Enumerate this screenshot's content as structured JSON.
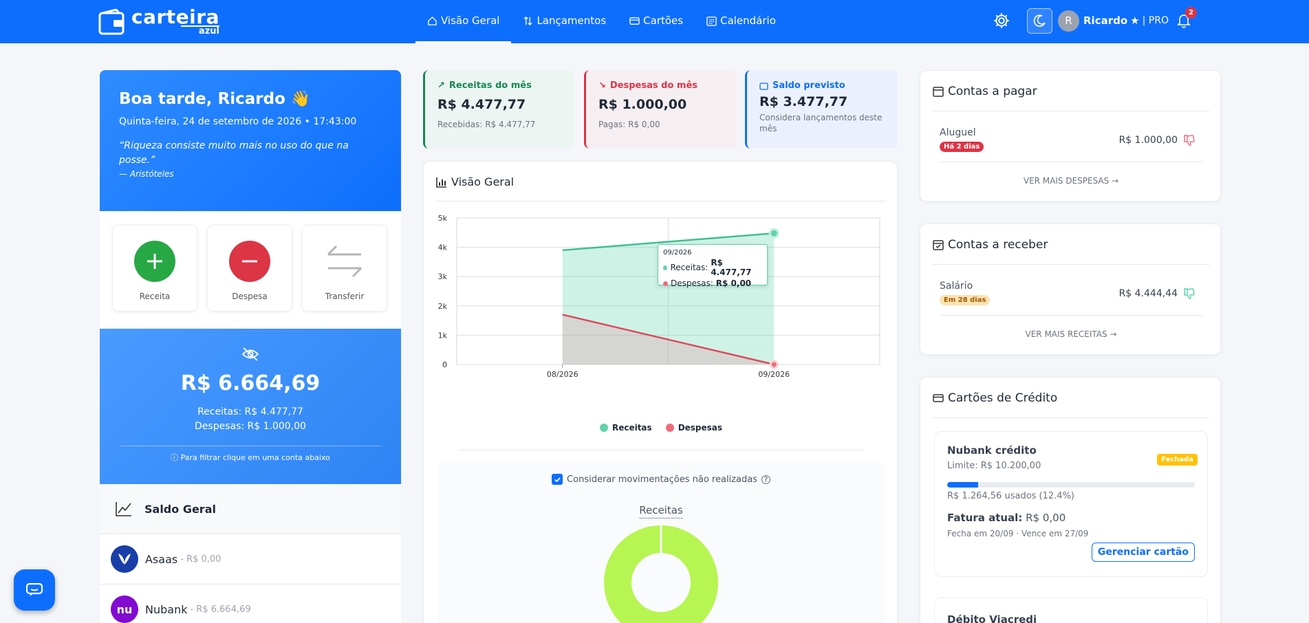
{
  "brand": {
    "name": "carteira",
    "sub": "azul"
  },
  "nav": [
    {
      "label": "Visão Geral",
      "icon": "home-icon",
      "active": true
    },
    {
      "label": "Lançamentos",
      "icon": "arrows-updown-icon"
    },
    {
      "label": "Cartões",
      "icon": "credit-card-icon"
    },
    {
      "label": "Calendário",
      "icon": "calendar-icon"
    }
  ],
  "user": {
    "initial": "R",
    "name": "Ricardo",
    "plan": "| PRO",
    "notifications": "2"
  },
  "greeting": {
    "title": "Boa tarde, Ricardo",
    "wave": "👋",
    "date": "Quinta-feira, 24 de setembro de 2026 • 17:43:00",
    "quote": "“Riqueza consiste muito mais no uso do que na posse.”",
    "author": "— Aristóteles"
  },
  "actions": [
    {
      "label": "Receita",
      "icon": "plus-icon",
      "color": "#28a745"
    },
    {
      "label": "Despesa",
      "icon": "minus-icon",
      "color": "#dc3545"
    },
    {
      "label": "Transferir",
      "icon": "transfer-icon",
      "color": "#b0b0b0"
    }
  ],
  "balance": {
    "total": "R$ 6.664,69",
    "receitas": "Receitas: R$ 4.477,77",
    "despesas": "Despesas: R$ 1.000,00",
    "hint": "ⓘ Para filtrar clique em uma conta abaixo"
  },
  "saldo_geral": "Saldo Geral",
  "accounts": [
    {
      "name": "Asaas",
      "value": "- R$ 0,00",
      "color": "#1a3ea8"
    },
    {
      "name": "Nubank",
      "value": "- R$ 6.664,69",
      "color": "#820ad1",
      "initials": "nu"
    }
  ],
  "stats": [
    {
      "title": "Receitas do mês",
      "value": "R$ 4.477,77",
      "sub": "Recebidas: R$ 4.477,77",
      "color": "#198754",
      "bg": "#edf5f3",
      "icon": "↗"
    },
    {
      "title": "Despesas do mês",
      "value": "R$ 1.000,00",
      "sub": "Pagas: R$ 0,00",
      "color": "#dc3545",
      "bg": "#f6eff2",
      "icon": "↘"
    },
    {
      "title": "Saldo previsto",
      "value": "R$ 3.477,77",
      "sub": "Considera lançamentos deste mês",
      "color": "#0d6efd",
      "bg": "#ebf0fc",
      "icon": "wallet-icon"
    }
  ],
  "overview_title": "Visão Geral",
  "chart_data": {
    "type": "area",
    "categories": [
      "08/2026",
      "09/2026"
    ],
    "series": [
      {
        "name": "Receitas",
        "values": [
          3900,
          4477.77
        ],
        "color": "#3fbf92"
      },
      {
        "name": "Despesas",
        "values": [
          1700,
          0
        ],
        "color": "#dc4a5a"
      }
    ],
    "yticks": [
      "0",
      "1k",
      "2k",
      "3k",
      "4k",
      "5k"
    ],
    "ylim": [
      0,
      5000
    ],
    "legend": "bottom"
  },
  "tooltip": {
    "date": "09/2026",
    "rec_label": "Receitas:",
    "rec_val": "R$ 4.477,77",
    "desp_label": "Despesas:",
    "desp_val": "R$ 0,00"
  },
  "consider_label": "Considerar movimentações não realizadas",
  "pie_title": "Receitas",
  "contas_pagar": {
    "title": "Contas a pagar",
    "item": "Aluguel",
    "badge": "Há 2 dias",
    "amount": "R$ 1.000,00",
    "more": "VER MAIS DESPESAS →"
  },
  "contas_receber": {
    "title": "Contas a receber",
    "item": "Salário",
    "badge": "Em 28 dias",
    "amount": "R$ 4.444,44",
    "more": "VER MAIS RECEITAS →"
  },
  "cartoes": {
    "title": "Cartões de Crédito",
    "card_name": "Nubank crédito",
    "limit": "Limite: R$ 10.200,00",
    "status": "Fechada",
    "usage_fraction": 0.124,
    "used": "R$ 1.264,56 usados (12.4%)",
    "fatura_label": "Fatura atual:",
    "fatura_value": "R$ 0,00",
    "dates": "Fecha em 20/09 · Vence em 27/09",
    "manage": "Gerenciar cartão",
    "next_card": "Débito Viacredi"
  }
}
